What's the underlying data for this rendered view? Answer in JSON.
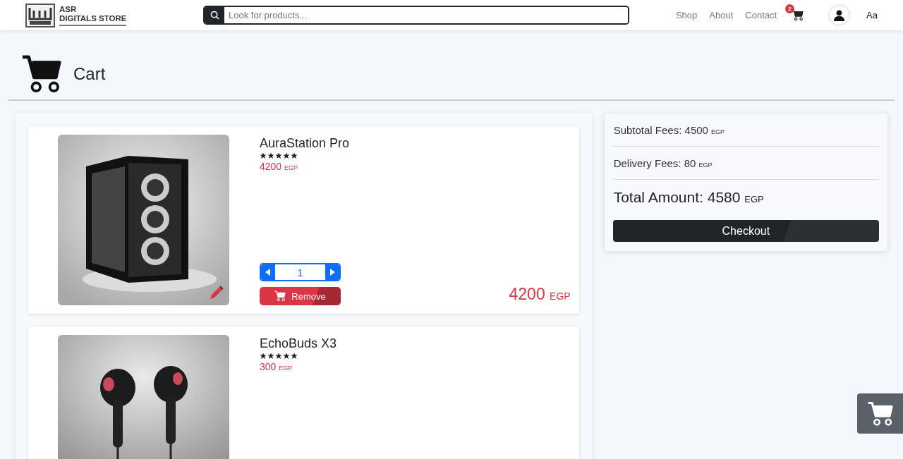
{
  "header": {
    "brand": [
      "ASR",
      "DIGITALS STORE"
    ],
    "search": {
      "placeholder": "Look for products..."
    },
    "nav": [
      "Shop",
      "About",
      "Contact"
    ],
    "cart_count": "2",
    "lang_icon": "Aa"
  },
  "page_title": "Cart",
  "items": [
    {
      "name": "AuraStation Pro",
      "stars": 5,
      "price": "4200",
      "currency": "EGP",
      "quantity": "1",
      "remove": "Remove",
      "line_total": "4200",
      "line_currency": "EGP"
    },
    {
      "name": "EchoBuds X3",
      "stars": 5,
      "price": "300",
      "currency": "EGP"
    }
  ],
  "summary": {
    "subtotal": {
      "label": "Subtotal Fees: 4500",
      "currency": "EGP"
    },
    "delivery": {
      "label": "Delivery Fees: 80",
      "currency": "EGP"
    },
    "total": {
      "label": "Total Amount: 4580",
      "currency": "EGP"
    },
    "checkout": "Checkout"
  }
}
